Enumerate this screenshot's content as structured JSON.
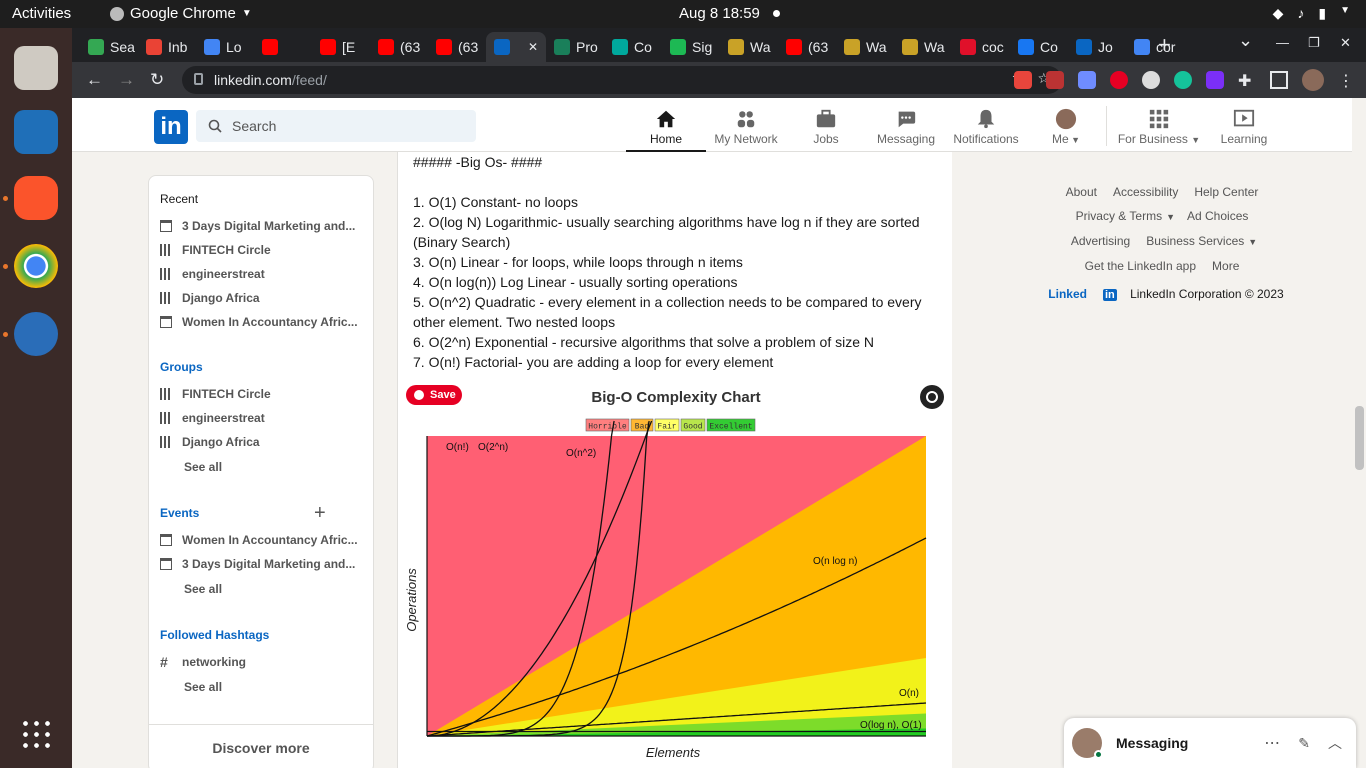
{
  "system": {
    "activities": "Activities",
    "app_name": "Google Chrome",
    "clock": "Aug 8  18:59"
  },
  "browser": {
    "tabs": [
      {
        "label": "Sea",
        "color": "#34a853"
      },
      {
        "label": "Inb",
        "color": "#ea4335"
      },
      {
        "label": "Lo",
        "color": "#4285f4"
      },
      {
        "label": "",
        "color": "#ff0000"
      },
      {
        "label": "[E",
        "color": "#ff0000"
      },
      {
        "label": "(63",
        "color": "#ff0000"
      },
      {
        "label": "(63",
        "color": "#ff0000"
      },
      {
        "label": "",
        "color": "#0a66c2",
        "active": true
      },
      {
        "label": "Pro",
        "color": "#1a7f5a"
      },
      {
        "label": "Co",
        "color": "#00a99d"
      },
      {
        "label": "Sig",
        "color": "#1db954"
      },
      {
        "label": "Wa",
        "color": "#c9a227"
      },
      {
        "label": "(63",
        "color": "#ff0000"
      },
      {
        "label": "Wa",
        "color": "#c9a227"
      },
      {
        "label": "Wa",
        "color": "#c9a227"
      },
      {
        "label": "coc",
        "color": "#e0102a"
      },
      {
        "label": "Co",
        "color": "#1877f2"
      },
      {
        "label": "Jo",
        "color": "#0a66c2"
      },
      {
        "label": "cor",
        "color": "#4285f4"
      }
    ],
    "url_host": "linkedin.com",
    "url_path": "/feed/"
  },
  "linkedin": {
    "logo": "in",
    "search_placeholder": "Search",
    "nav": [
      {
        "label": "Home",
        "active": true,
        "icon": "home-icon"
      },
      {
        "label": "My Network",
        "icon": "network-icon"
      },
      {
        "label": "Jobs",
        "icon": "jobs-icon"
      },
      {
        "label": "Messaging",
        "icon": "messaging-icon"
      },
      {
        "label": "Notifications",
        "icon": "bell-icon"
      },
      {
        "label": "Me",
        "icon": "avatar"
      }
    ],
    "for_business": "For Business",
    "learning": "Learning"
  },
  "sidebar": {
    "recent_title": "Recent",
    "recent": [
      "3 Days Digital Marketing and...",
      "FINTECH Circle",
      "engineerstreat",
      "Django Africa",
      "Women In Accountancy Afric..."
    ],
    "groups_title": "Groups",
    "groups": [
      "FINTECH Circle",
      "engineerstreat",
      "Django Africa"
    ],
    "groups_see_all": "See all",
    "events_title": "Events",
    "events": [
      "Women In Accountancy Afric...",
      "3 Days Digital Marketing and..."
    ],
    "events_see_all": "See all",
    "hashtags_title": "Followed Hashtags",
    "hashtags": [
      "networking"
    ],
    "hashtags_see_all": "See all",
    "discover": "Discover more"
  },
  "post": {
    "heading": "##### -Big Os- ####",
    "lines": [
      "1. O(1) Constant- no loops",
      "2. O(log N) Logarithmic- usually searching algorithms have log n if they are sorted (Binary Search)",
      "3. O(n) Linear - for loops, while loops through n items",
      "4. O(n log(n)) Log Linear - usually sorting operations",
      "5. O(n^2) Quadratic - every element in a collection needs to be compared to every other element. Two nested loops",
      "6. O(2^n) Exponential - recursive algorithms that solve a problem of size N",
      "7. O(n!) Factorial- you are adding a loop for every element"
    ],
    "save_label": "Save"
  },
  "chart_data": {
    "type": "line",
    "title": "Big-O Complexity Chart",
    "xlabel": "Elements",
    "ylabel": "Operations",
    "legend": [
      {
        "label": "Horrible",
        "color": "#ff7f7f"
      },
      {
        "label": "Bad",
        "color": "#ffb733"
      },
      {
        "label": "Fair",
        "color": "#ffff66"
      },
      {
        "label": "Good",
        "color": "#b8e64c"
      },
      {
        "label": "Excellent",
        "color": "#33cc33"
      }
    ],
    "series": [
      {
        "name": "O(n!)"
      },
      {
        "name": "O(2^n)"
      },
      {
        "name": "O(n^2)"
      },
      {
        "name": "O(n log n)"
      },
      {
        "name": "O(n)"
      },
      {
        "name": "O(log n), O(1)"
      }
    ]
  },
  "footer": {
    "row1": [
      "About",
      "Accessibility",
      "Help Center"
    ],
    "row2": [
      "Privacy & Terms",
      "Ad Choices"
    ],
    "row3": [
      "Advertising",
      "Business Services"
    ],
    "row4": [
      "Get the LinkedIn app",
      "More"
    ],
    "brand": "Linked",
    "copyright": "LinkedIn Corporation © 2023"
  },
  "messaging": {
    "label": "Messaging"
  }
}
